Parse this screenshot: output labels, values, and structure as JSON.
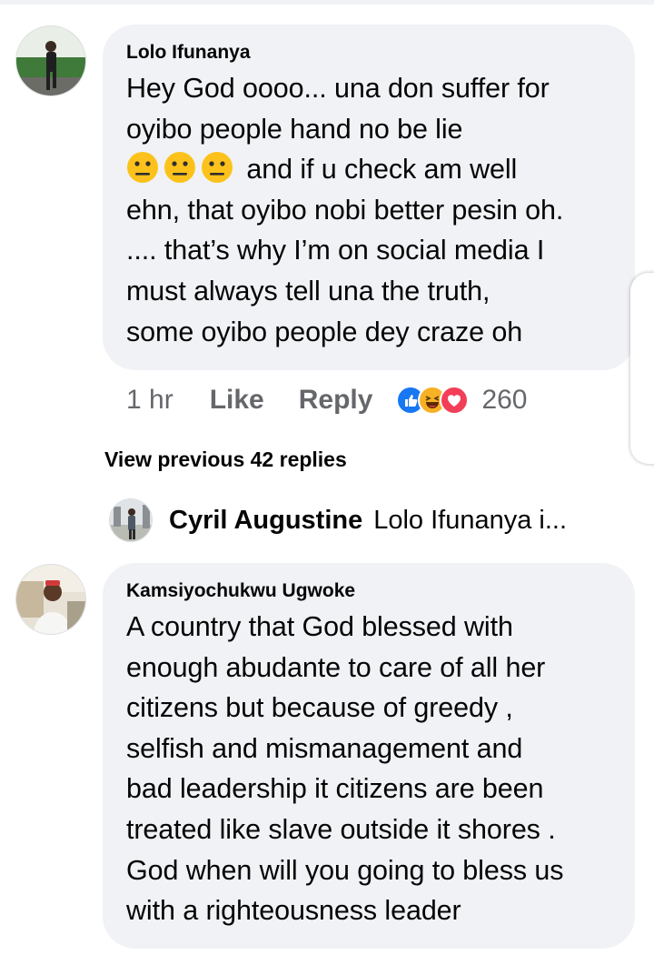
{
  "comments": [
    {
      "author": "Lolo Ifunanya",
      "lines": [
        "Hey God oooo... una don suffer for",
        "oyibo people hand no be lie",
        "and if u check am well",
        "ehn, that oyibo nobi better pesin oh.",
        ".... that’s why I’m on social media I",
        "must always tell una the truth,",
        "some oyibo people dey craze oh"
      ],
      "emoji": [
        "neutral-face",
        "neutral-face",
        "neutral-face"
      ],
      "time": "1 hr",
      "like_label": "Like",
      "reply_label": "Reply",
      "reaction_icons": [
        "like-reaction-icon",
        "haha-reaction-icon",
        "love-reaction-icon"
      ],
      "reaction_count": "260"
    },
    {
      "author": "Kamsiyochukwu Ugwoke",
      "lines": [
        "A country that God blessed with",
        "enough abudante to care of all her",
        "citizens but because of greedy ,",
        "selfish and mismanagement and",
        "bad leadership it citizens are been",
        "treated like slave outside it shores .",
        "God when will you going to bless us",
        "with a righteousness leader"
      ]
    }
  ],
  "view_previous": "View previous 42 replies",
  "reply_preview": {
    "author": "Cyril Augustine",
    "text": "Lolo Ifunanya i..."
  },
  "colors": {
    "bubble": "#f0f2f5",
    "secondary_text": "#65676b",
    "like_blue": "#1877f2",
    "love_red": "#f33e58",
    "haha_yellow": "#f7b125"
  }
}
